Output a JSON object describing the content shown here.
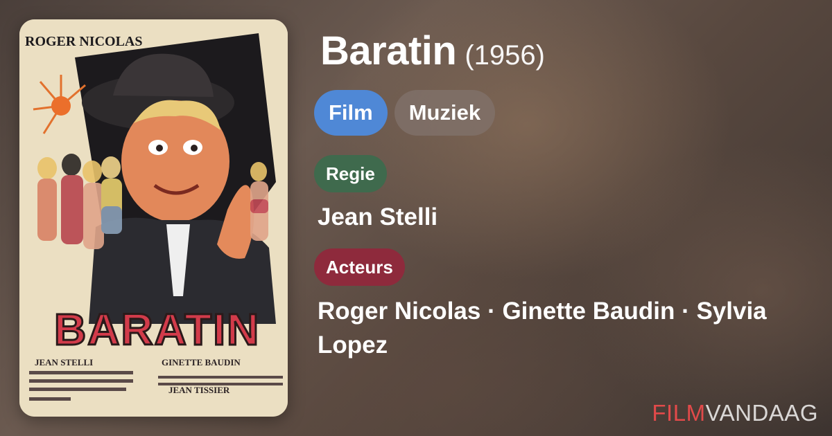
{
  "movie": {
    "title": "Baratin",
    "year": "(1956)"
  },
  "types": {
    "film": "Film",
    "muziek": "Muziek"
  },
  "sections": {
    "director_label": "Regie",
    "director": "Jean Stelli",
    "cast_label": "Acteurs",
    "cast": "Roger Nicolas · Ginette Baudin · Sylvia Lopez"
  },
  "poster": {
    "top_name": "ROGER NICOLAS",
    "title_art": "BARATIN",
    "credit_left_1": "JEAN STELLI",
    "credit_right_1": "GINETTE BAUDIN",
    "credit_right_2": "JEAN TISSIER"
  },
  "logo": {
    "part1": "FILM",
    "part2": "VANDAAG"
  },
  "colors": {
    "film_pill": "#4f88d6",
    "regie_pill": "#3f6a4d",
    "acteurs_pill": "#8e2a3c",
    "logo_accent": "#e24a4a"
  }
}
